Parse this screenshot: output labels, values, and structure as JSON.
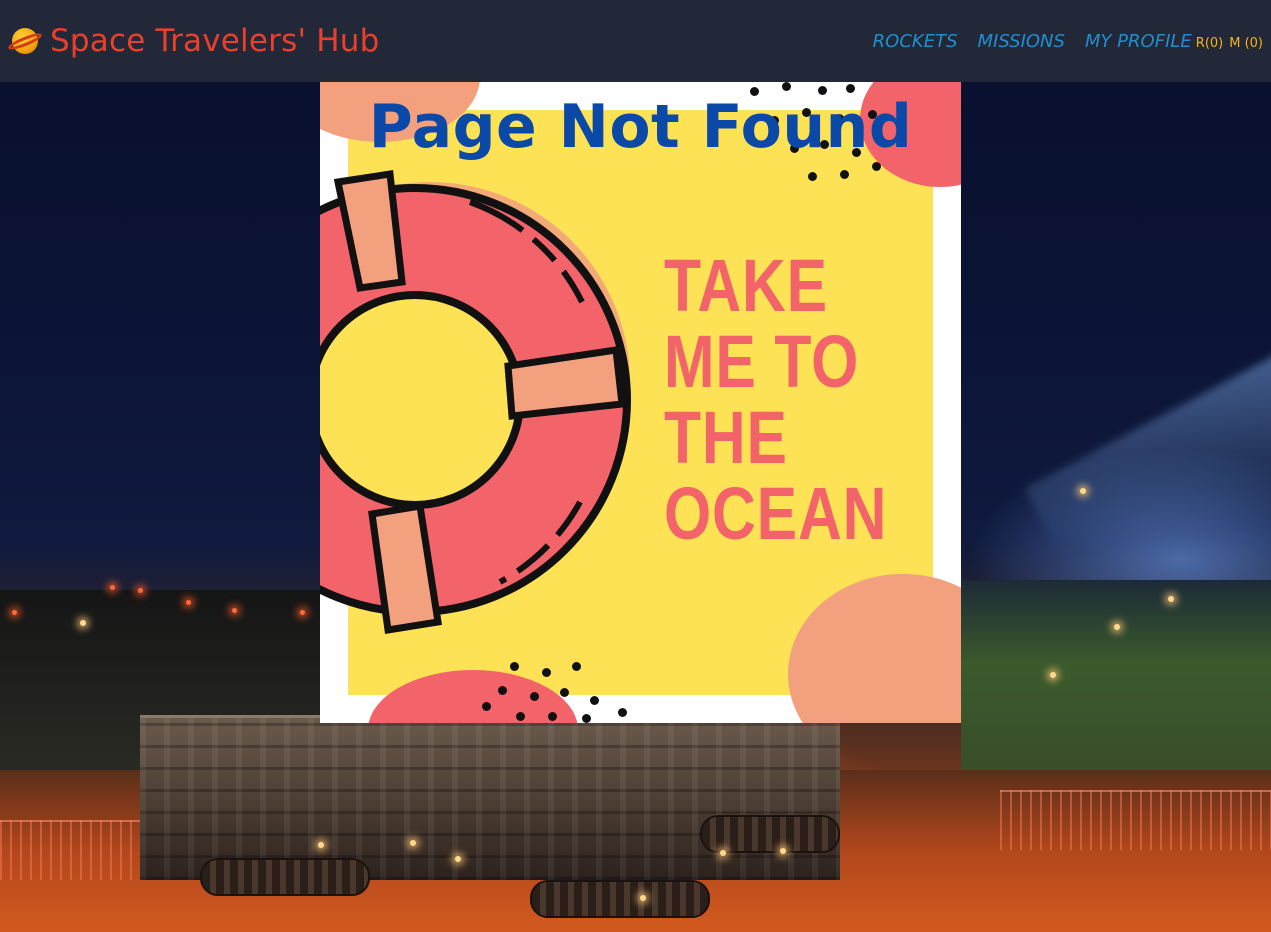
{
  "header": {
    "brand": "Space Travelers' Hub",
    "nav": [
      {
        "label": "ROCKETS"
      },
      {
        "label": "MISSIONS"
      },
      {
        "label": "MY PROFILE"
      }
    ],
    "counts": {
      "rockets": "R(0)",
      "missions": "M (0)"
    }
  },
  "card": {
    "title": "Page Not Found",
    "tagline_lines": [
      "TAKE",
      "ME TO",
      "THE",
      "OCEAN"
    ]
  },
  "colors": {
    "header_bg": "#222838",
    "brand": "#e8402a",
    "nav_link": "#1f8fd0",
    "count": "#f2b41a",
    "card_title": "#0a49a8",
    "card_yellow": "#fde255",
    "coral": "#f2646a",
    "salmon": "#f2a07e"
  },
  "icons": {
    "logo": "planet-icon",
    "buoy": "lifebuoy-icon"
  }
}
